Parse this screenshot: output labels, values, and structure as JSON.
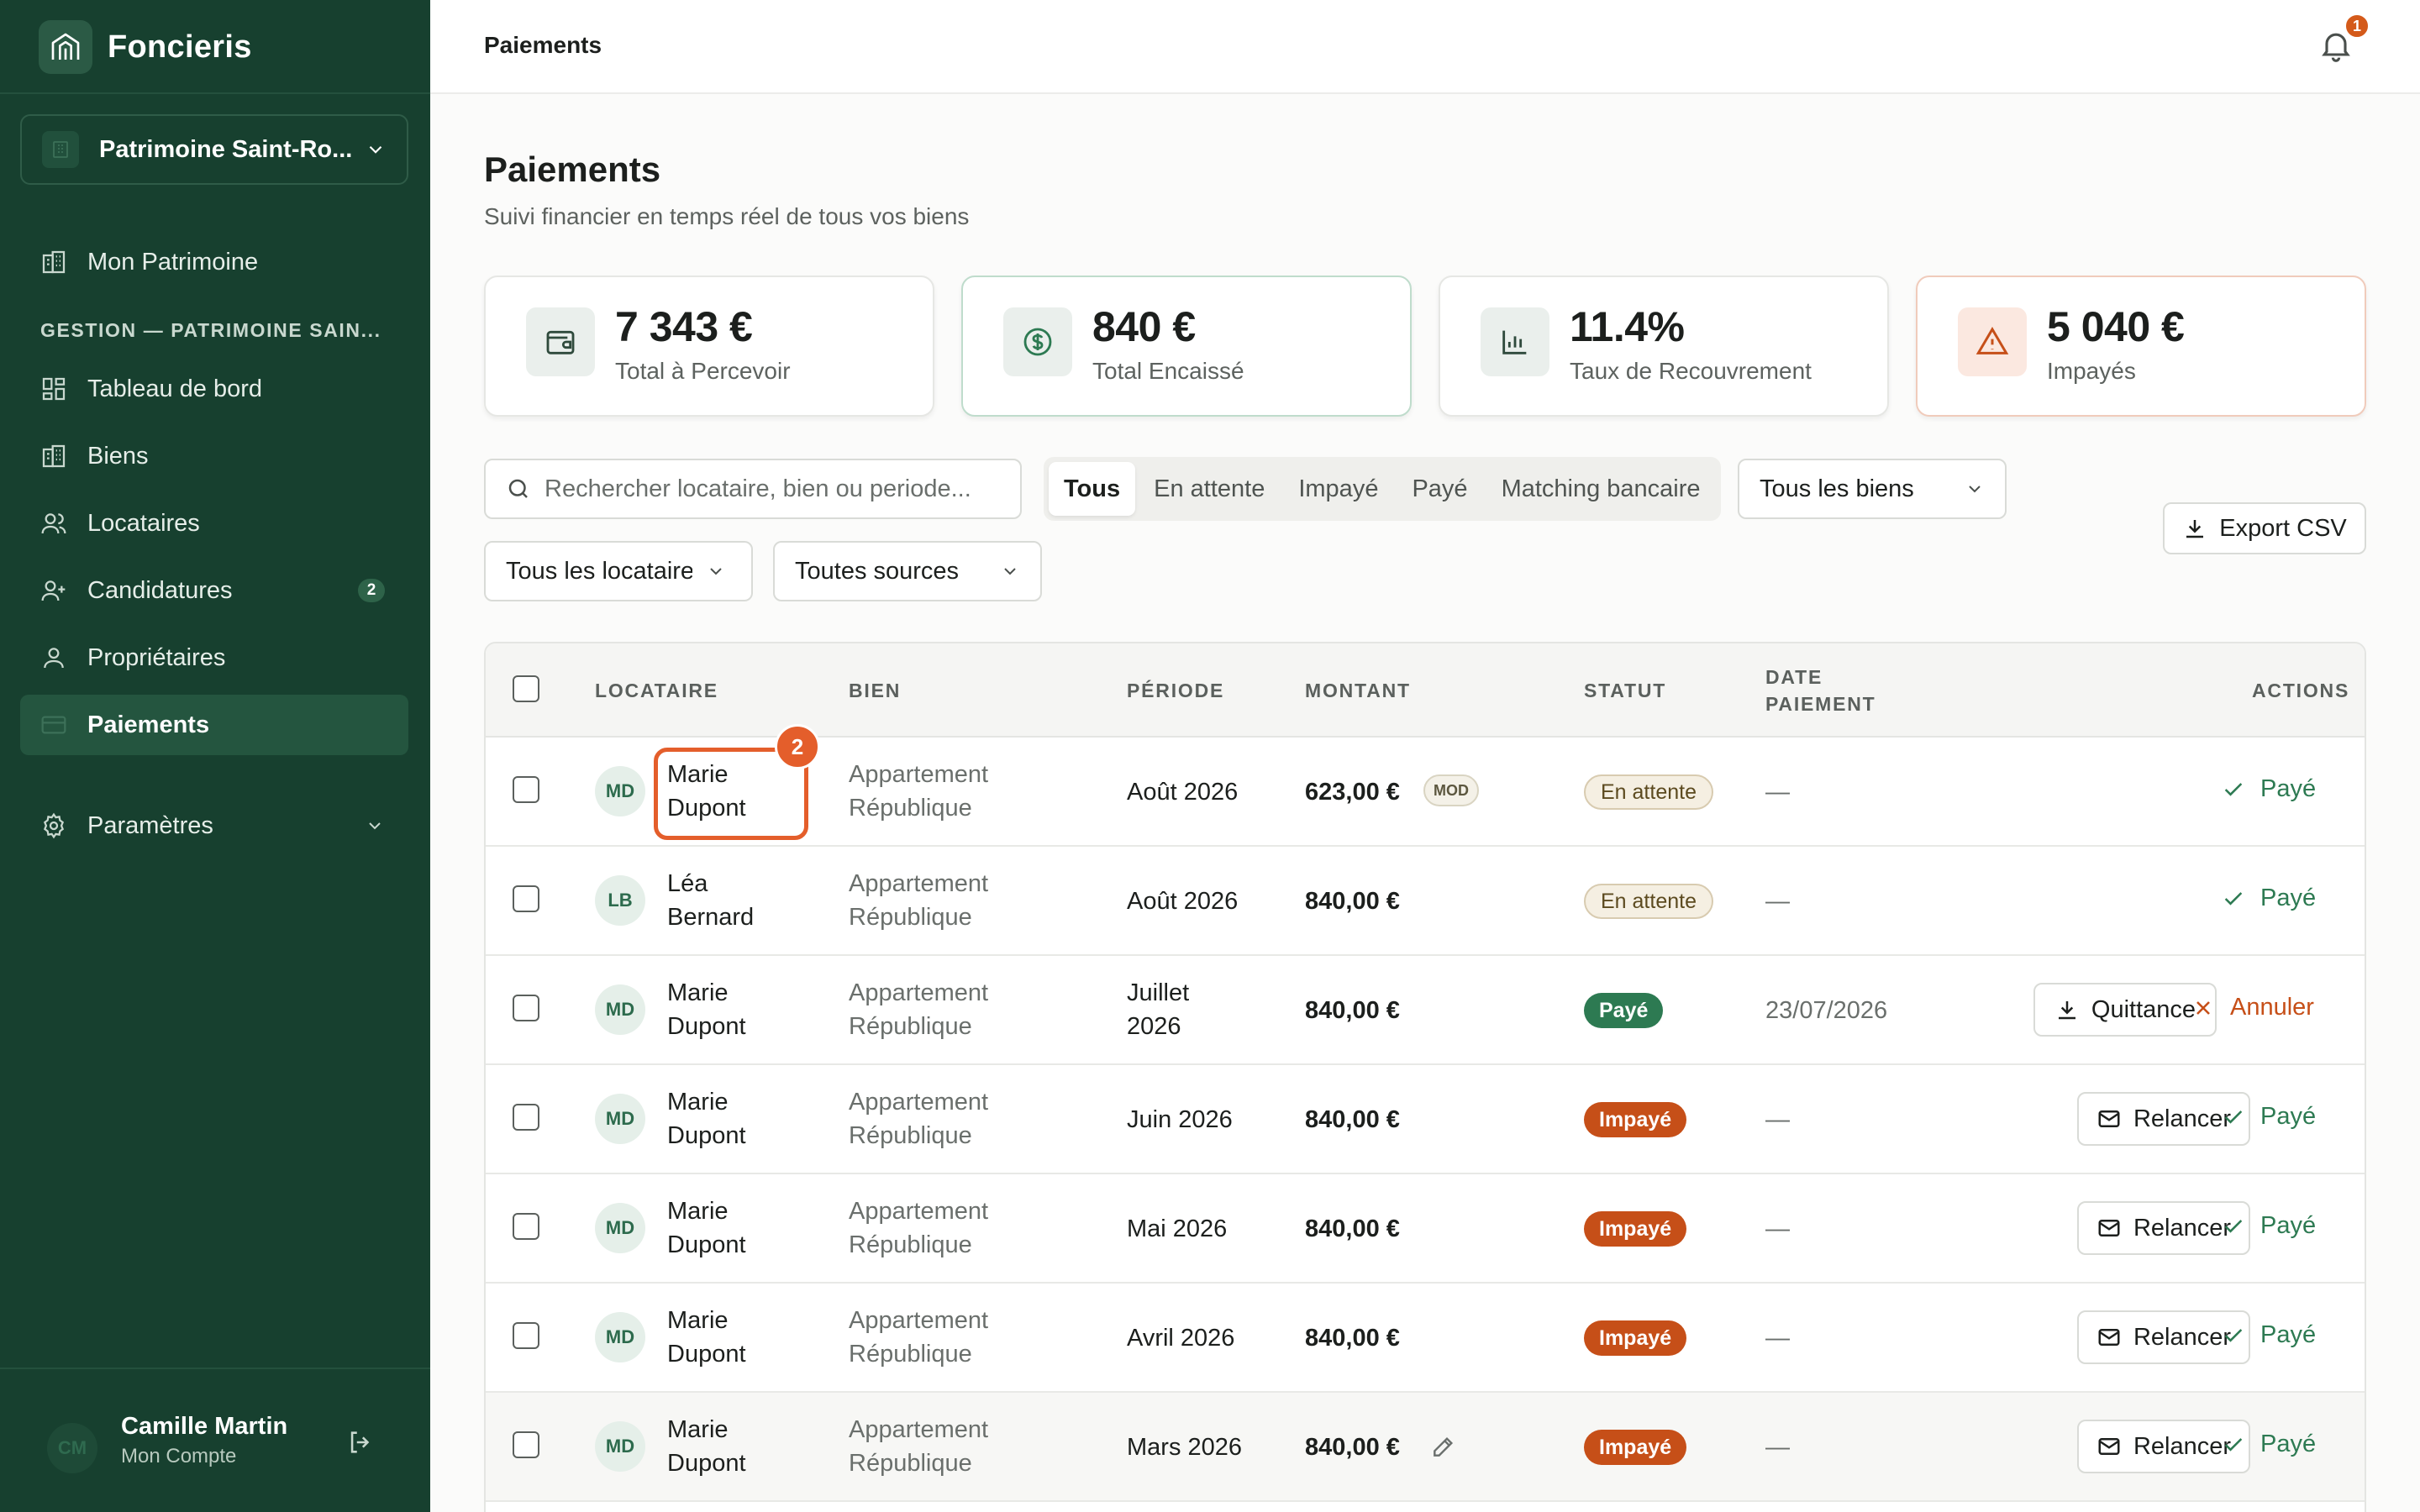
{
  "app": {
    "brand_name": "Foncieris",
    "logo_icon": "building-icon"
  },
  "workspace": {
    "name": "Patrimoine Saint-Ro...",
    "icon": "building-icon"
  },
  "sidebar": {
    "top_item": {
      "label": "Mon Patrimoine",
      "icon": "building-icon"
    },
    "section_title": "GESTION — PATRIMOINE SAIN...",
    "items": [
      {
        "label": "Tableau de bord",
        "icon": "dashboard-icon"
      },
      {
        "label": "Biens",
        "icon": "building-icon"
      },
      {
        "label": "Locataires",
        "icon": "users-icon"
      },
      {
        "label": "Candidatures",
        "icon": "user-plus-icon",
        "count": "2"
      },
      {
        "label": "Propriétaires",
        "icon": "user-icon"
      },
      {
        "label": "Paiements",
        "icon": "card-icon",
        "active": true
      }
    ],
    "settings": {
      "label": "Paramètres",
      "icon": "gear-icon"
    }
  },
  "account": {
    "initials": "CM",
    "name": "Camille Martin",
    "subtitle": "Mon Compte"
  },
  "topbar": {
    "title": "Paiements",
    "notification_count": "1"
  },
  "page": {
    "title": "Paiements",
    "subtitle": "Suivi financier en temps réel de tous vos biens"
  },
  "kpis": [
    {
      "value": "7 343 €",
      "label": "Total à Percevoir",
      "icon": "wallet-icon"
    },
    {
      "value": "840 €",
      "label": "Total Encaissé",
      "icon": "dollar-circle-icon"
    },
    {
      "value": "11.4%",
      "label": "Taux de Recouvrement",
      "icon": "bar-chart-icon"
    },
    {
      "value": "5 040 €",
      "label": "Impayés",
      "icon": "warning-icon"
    }
  ],
  "filters": {
    "search_placeholder": "Rechercher locataire, bien ou periode...",
    "tabs": [
      "Tous",
      "En attente",
      "Impayé",
      "Payé",
      "Matching bancaire"
    ],
    "active_tab": "Tous",
    "property_select": "Tous les biens",
    "tenant_select": "Tous les locataires",
    "source_select": "Toutes sources",
    "export_label": "Export CSV"
  },
  "table": {
    "headers": {
      "tenant": "LOCATAIRE",
      "property": "BIEN",
      "period": "PÉRIODE",
      "amount": "MONTANT",
      "status": "STATUT",
      "date": "DATE PAIEMENT",
      "actions": "ACTIONS"
    },
    "rows": [
      {
        "initials": "MD",
        "tenant": "Marie Dupont",
        "property": "Appartement République",
        "period": "Août 2026",
        "amount": "623,00 €",
        "tag": "MOD",
        "status": "En attente",
        "status_kind": "pending",
        "date": "—",
        "actions": [
          "Payé"
        ]
      },
      {
        "initials": "LB",
        "tenant": "Léa Bernard",
        "property": "Appartement République",
        "period": "Août 2026",
        "amount": "840,00 €",
        "status": "En attente",
        "status_kind": "pending",
        "date": "—",
        "actions": [
          "Payé"
        ]
      },
      {
        "initials": "MD",
        "tenant": "Marie Dupont",
        "property": "Appartement République",
        "period": "Juillet 2026",
        "amount": "840,00 €",
        "status": "Payé",
        "status_kind": "paid",
        "date": "23/07/2026",
        "actions": [
          "Quittance",
          "Annuler"
        ]
      },
      {
        "initials": "MD",
        "tenant": "Marie Dupont",
        "property": "Appartement République",
        "period": "Juin 2026",
        "amount": "840,00 €",
        "status": "Impayé",
        "status_kind": "unpaid",
        "date": "—",
        "actions": [
          "Relancer",
          "Payé"
        ]
      },
      {
        "initials": "MD",
        "tenant": "Marie Dupont",
        "property": "Appartement République",
        "period": "Mai 2026",
        "amount": "840,00 €",
        "status": "Impayé",
        "status_kind": "unpaid",
        "date": "—",
        "actions": [
          "Relancer",
          "Payé"
        ]
      },
      {
        "initials": "MD",
        "tenant": "Marie Dupont",
        "property": "Appartement République",
        "period": "Avril 2026",
        "amount": "840,00 €",
        "status": "Impayé",
        "status_kind": "unpaid",
        "date": "—",
        "actions": [
          "Relancer",
          "Payé"
        ]
      },
      {
        "initials": "MD",
        "tenant": "Marie Dupont",
        "property": "Appartement République",
        "period": "Mars 2026",
        "amount": "840,00 €",
        "status": "Impayé",
        "status_kind": "unpaid",
        "date": "—",
        "actions": [
          "Relancer",
          "Payé"
        ],
        "edit_icon": "pencil-icon"
      }
    ]
  },
  "overlay": {
    "marker_number": "2"
  },
  "colors": {
    "sidebar_bg": "#17402f",
    "accent_green": "#2d7a52",
    "accent_orange": "#c64f18",
    "highlight": "#e45e2b"
  }
}
